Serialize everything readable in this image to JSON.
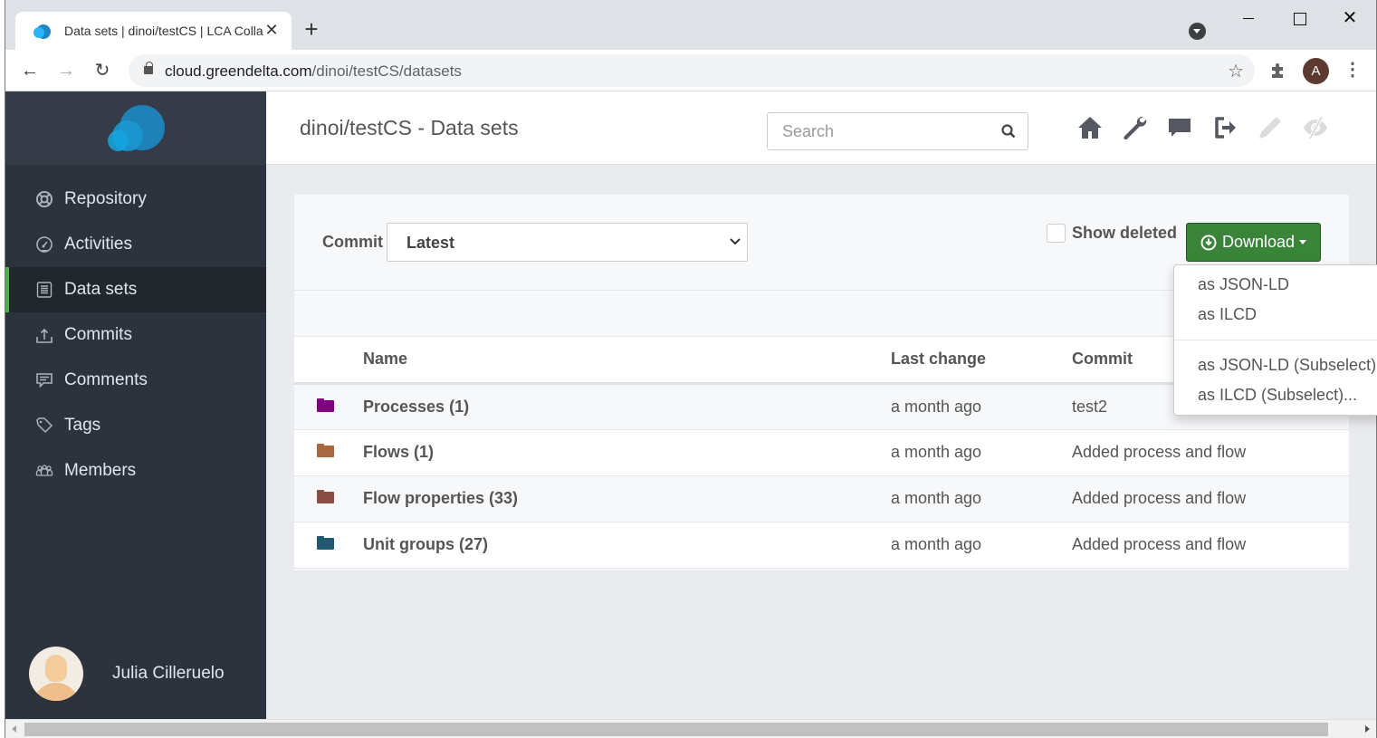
{
  "browser": {
    "tab_title": "Data sets | dinoi/testCS | LCA Collaboration Server",
    "tab_close": "✕",
    "new_tab": "+",
    "url_host": "cloud.greendelta.com",
    "url_path": "/dinoi/testCS/datasets",
    "profile_initial": "A",
    "nav_back": "←",
    "nav_forward": "→",
    "nav_reload": "↻",
    "star": "☆",
    "menu": "⋮",
    "win_close": "✕"
  },
  "sidebar": {
    "items": [
      {
        "label": "Repository",
        "icon": "life-ring-icon"
      },
      {
        "label": "Activities",
        "icon": "dashboard-icon"
      },
      {
        "label": "Data sets",
        "icon": "list-alt-icon",
        "active": true
      },
      {
        "label": "Commits",
        "icon": "upload-icon"
      },
      {
        "label": "Comments",
        "icon": "comment-icon"
      },
      {
        "label": "Tags",
        "icon": "tags-icon"
      },
      {
        "label": "Members",
        "icon": "users-icon"
      }
    ],
    "user_name": "Julia Cilleruelo"
  },
  "header": {
    "title": "dinoi/testCS - Data sets",
    "search_placeholder": "Search",
    "icons": [
      "home-icon",
      "wrench-icon",
      "comment-icon",
      "sign-out-icon",
      "pencil-icon",
      "eye-slash-icon"
    ]
  },
  "toolbar": {
    "commit_label": "Commit",
    "commit_value": "Latest",
    "show_deleted_label": "Show deleted",
    "show_deleted_checked": false,
    "download_label": "Download",
    "download_color": "#398439"
  },
  "download_menu": {
    "items": [
      "as JSON-LD",
      "as ILCD",
      "as JSON-LD (Subselect)...",
      "as ILCD (Subselect)..."
    ]
  },
  "table": {
    "columns": [
      "",
      "Name",
      "Last change",
      "Commit"
    ],
    "rows": [
      {
        "name": "Processes (1)",
        "last_change": "a month ago",
        "commit": "test2",
        "folder_color": "#800080"
      },
      {
        "name": "Flows (1)",
        "last_change": "a month ago",
        "commit": "Added process and flow",
        "folder_color": "#a86641"
      },
      {
        "name": "Flow properties (33)",
        "last_change": "a month ago",
        "commit": "Added process and flow",
        "folder_color": "#8a4e44"
      },
      {
        "name": "Unit groups (27)",
        "last_change": "a month ago",
        "commit": "Added process and flow",
        "folder_color": "#23596f"
      }
    ]
  }
}
